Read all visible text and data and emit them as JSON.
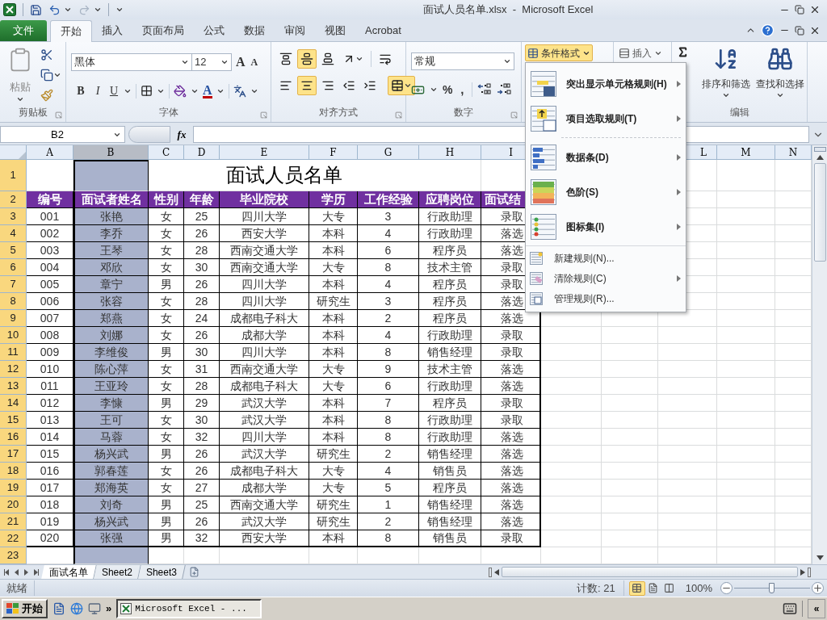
{
  "window": {
    "title": "面试人员名单.xlsx  -  Microsoft Excel"
  },
  "ribbon": {
    "file_tab": "文件",
    "tabs": [
      {
        "label": "开始",
        "selected": true
      },
      {
        "label": "插入",
        "selected": false
      },
      {
        "label": "页面布局",
        "selected": false
      },
      {
        "label": "公式",
        "selected": false
      },
      {
        "label": "数据",
        "selected": false
      },
      {
        "label": "审阅",
        "selected": false
      },
      {
        "label": "视图",
        "selected": false
      },
      {
        "label": "Acrobat",
        "selected": false
      }
    ],
    "clipboard": {
      "paste": "粘贴",
      "label": "剪贴板"
    },
    "font": {
      "name": "黑体",
      "size": "12",
      "grow": "A",
      "shrink": "A",
      "bold": "B",
      "italic": "I",
      "underline": "U",
      "font_color": "A",
      "label": "字体"
    },
    "alignment": {
      "rows": [
        [
          {
            "kind": "top",
            "selected": false
          },
          {
            "kind": "middle",
            "selected": true
          },
          {
            "kind": "bottom",
            "selected": false
          },
          {
            "kind": "orientation",
            "selected": false
          },
          {
            "kind": "wrap",
            "selected": false
          }
        ],
        [
          {
            "kind": "left",
            "selected": false
          },
          {
            "kind": "center",
            "selected": true
          },
          {
            "kind": "right",
            "selected": false
          },
          {
            "kind": "outdent",
            "selected": false
          },
          {
            "kind": "indent",
            "selected": false
          },
          {
            "kind": "merge",
            "selected": true
          }
        ]
      ],
      "label": "对齐方式"
    },
    "number": {
      "format": "常规",
      "percent": "%",
      "comma": ",",
      "label": "数字"
    },
    "conditional_format": {
      "label": "条件格式",
      "open": true
    },
    "insert": "插入",
    "sort": "排序和筛选",
    "find": "查找和选择",
    "editing_label": "编辑"
  },
  "formula_bar": {
    "name_box": "B2",
    "fx": "fx"
  },
  "sheet": {
    "columns": [
      {
        "label": "A",
        "selected": false
      },
      {
        "label": "B",
        "selected": true
      },
      {
        "label": "C",
        "selected": false
      },
      {
        "label": "D",
        "selected": false
      },
      {
        "label": "E",
        "selected": false
      },
      {
        "label": "F",
        "selected": false
      },
      {
        "label": "G",
        "selected": false
      },
      {
        "label": "H",
        "selected": false
      },
      {
        "label": "I",
        "selected": false
      },
      {
        "label": "L",
        "selected": false
      },
      {
        "label": "M",
        "selected": false
      },
      {
        "label": "N",
        "selected": false
      }
    ],
    "row_headers": [
      {
        "number": "1",
        "selected": true
      },
      {
        "number": "2",
        "selected": true
      },
      {
        "number": "3",
        "selected": true
      },
      {
        "number": "4",
        "selected": true
      },
      {
        "number": "5",
        "selected": true
      },
      {
        "number": "6",
        "selected": true
      },
      {
        "number": "7",
        "selected": true
      },
      {
        "number": "8",
        "selected": true
      },
      {
        "number": "9",
        "selected": true
      },
      {
        "number": "10",
        "selected": true
      },
      {
        "number": "11",
        "selected": true
      },
      {
        "number": "12",
        "selected": true
      },
      {
        "number": "13",
        "selected": true
      },
      {
        "number": "14",
        "selected": true
      },
      {
        "number": "15",
        "selected": true
      },
      {
        "number": "16",
        "selected": true
      },
      {
        "number": "17",
        "selected": true
      },
      {
        "number": "18",
        "selected": true
      },
      {
        "number": "19",
        "selected": true
      },
      {
        "number": "20",
        "selected": true
      },
      {
        "number": "21",
        "selected": true
      },
      {
        "number": "22",
        "selected": true
      },
      {
        "number": "23",
        "selected": true
      }
    ],
    "title": "面试人员名单",
    "header": [
      "编号",
      "面试者姓名",
      "性别",
      "年龄",
      "毕业院校",
      "学历",
      "工作经验",
      "应聘岗位",
      "面试结"
    ],
    "records": [
      [
        "001",
        "张艳",
        "女",
        "25",
        "四川大学",
        "大专",
        "3",
        "行政助理",
        "录取"
      ],
      [
        "002",
        "李乔",
        "女",
        "26",
        "西安大学",
        "本科",
        "4",
        "行政助理",
        "落选"
      ],
      [
        "003",
        "王琴",
        "女",
        "28",
        "西南交通大学",
        "本科",
        "6",
        "程序员",
        "落选"
      ],
      [
        "004",
        "邓欣",
        "女",
        "30",
        "西南交通大学",
        "大专",
        "8",
        "技术主管",
        "录取"
      ],
      [
        "005",
        "章宁",
        "男",
        "26",
        "四川大学",
        "本科",
        "4",
        "程序员",
        "录取"
      ],
      [
        "006",
        "张容",
        "女",
        "28",
        "四川大学",
        "研究生",
        "3",
        "程序员",
        "落选"
      ],
      [
        "007",
        "郑燕",
        "女",
        "24",
        "成都电子科大",
        "本科",
        "2",
        "程序员",
        "落选"
      ],
      [
        "008",
        "刘娜",
        "女",
        "26",
        "成都大学",
        "本科",
        "4",
        "行政助理",
        "录取"
      ],
      [
        "009",
        "李维俊",
        "男",
        "30",
        "四川大学",
        "本科",
        "8",
        "销售经理",
        "录取"
      ],
      [
        "010",
        "陈心萍",
        "女",
        "31",
        "西南交通大学",
        "大专",
        "9",
        "技术主管",
        "落选"
      ],
      [
        "011",
        "王亚玲",
        "女",
        "28",
        "成都电子科大",
        "大专",
        "6",
        "行政助理",
        "落选"
      ],
      [
        "012",
        "李慷",
        "男",
        "29",
        "武汉大学",
        "本科",
        "7",
        "程序员",
        "录取"
      ],
      [
        "013",
        "王可",
        "女",
        "30",
        "武汉大学",
        "本科",
        "8",
        "行政助理",
        "录取"
      ],
      [
        "014",
        "马蓉",
        "女",
        "32",
        "四川大学",
        "本科",
        "8",
        "行政助理",
        "落选"
      ],
      [
        "015",
        "杨兴武",
        "男",
        "26",
        "武汉大学",
        "研究生",
        "2",
        "销售经理",
        "落选"
      ],
      [
        "016",
        "郭春莲",
        "女",
        "26",
        "成都电子科大",
        "大专",
        "4",
        "销售员",
        "落选"
      ],
      [
        "017",
        "郑海英",
        "女",
        "27",
        "成都大学",
        "大专",
        "5",
        "程序员",
        "落选"
      ],
      [
        "018",
        "刘奇",
        "男",
        "25",
        "西南交通大学",
        "研究生",
        "1",
        "销售经理",
        "落选"
      ],
      [
        "019",
        "杨兴武",
        "男",
        "26",
        "武汉大学",
        "研究生",
        "2",
        "销售经理",
        "落选"
      ],
      [
        "020",
        "张强",
        "男",
        "32",
        "西安大学",
        "本科",
        "8",
        "销售员",
        "录取"
      ]
    ]
  },
  "menu": {
    "items": [
      {
        "kind": "highlight",
        "label": "突出显示单元格规则(H)",
        "submenu": true
      },
      {
        "kind": "top10",
        "label": "项目选取规则(T)",
        "submenu": true
      },
      {
        "kind": "separator-dashed"
      },
      {
        "kind": "databar",
        "label": "数据条(D)",
        "submenu": true
      },
      {
        "kind": "colorscale",
        "label": "色阶(S)",
        "submenu": true
      },
      {
        "kind": "iconset",
        "label": "图标集(I)",
        "submenu": true
      },
      {
        "kind": "separator"
      },
      {
        "kind": "new",
        "label": "新建规则(N)...",
        "submenu": false
      },
      {
        "kind": "clear",
        "label": "清除规则(C)",
        "submenu": true
      },
      {
        "kind": "manage",
        "label": "管理规则(R)...",
        "submenu": false
      }
    ]
  },
  "sheet_tabs": [
    {
      "label": "面试名单",
      "selected": true
    },
    {
      "label": "Sheet2",
      "selected": false
    },
    {
      "label": "Sheet3",
      "selected": false
    }
  ],
  "status_bar": {
    "ready": "就绪",
    "count": "计数: 21",
    "views": [
      {
        "kind": "normal",
        "selected": true
      },
      {
        "kind": "layout",
        "selected": false
      },
      {
        "kind": "break",
        "selected": false
      }
    ],
    "zoom": "100%",
    "zoom_slider": {
      "level": 0.5
    }
  },
  "taskbar": {
    "start": "开始",
    "more": "»",
    "window": "Microsoft Excel - ...",
    "tray_button": "«"
  }
}
